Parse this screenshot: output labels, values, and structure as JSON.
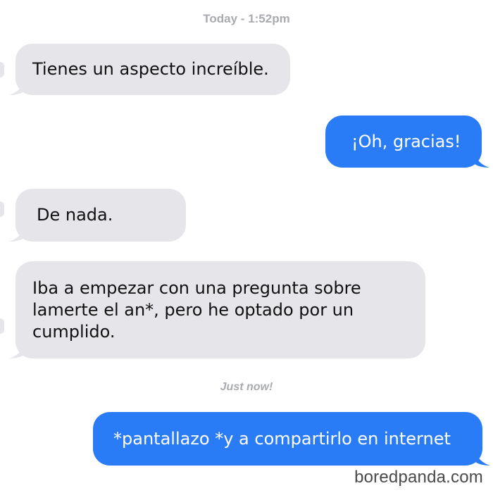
{
  "conversation": {
    "timestamp_top": "Today - 1:52pm",
    "timestamp_bottom": "Just now!",
    "messages": [
      {
        "side": "received",
        "text": "Tienes un aspecto increíble."
      },
      {
        "side": "sent",
        "text": "¡Oh, gracias!"
      },
      {
        "side": "received",
        "text": "De nada."
      },
      {
        "side": "received",
        "text": "Iba a empezar con una pregunta sobre lamerte el an*, pero he optado por un cumplido."
      },
      {
        "side": "sent",
        "text": "*pantallazo *y a compartirlo en internet"
      }
    ]
  },
  "watermark": "boredpanda.com",
  "colors": {
    "sent_bubble": "#2a7cf6",
    "received_bubble": "#e6e6ea",
    "timestamp": "#a9abb0"
  }
}
